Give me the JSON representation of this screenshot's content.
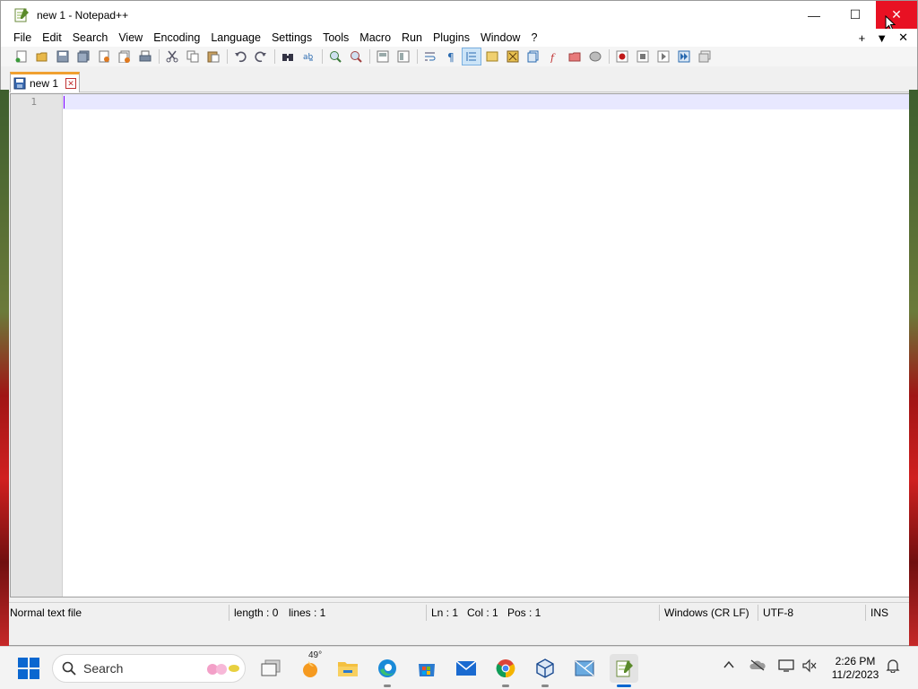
{
  "window": {
    "title": "new 1 - Notepad++",
    "controls": {
      "minimize": "—",
      "maximize": "☐",
      "close": "✕"
    }
  },
  "menu": {
    "items": [
      "File",
      "Edit",
      "Search",
      "View",
      "Encoding",
      "Language",
      "Settings",
      "Tools",
      "Macro",
      "Run",
      "Plugins",
      "Window",
      "?"
    ],
    "right_controls": [
      "+",
      "▼",
      "✕"
    ]
  },
  "toolbar": {
    "icons": [
      "new-file-icon",
      "open-file-icon",
      "save-icon",
      "save-all-icon",
      "close-icon",
      "close-all-icon",
      "print-icon",
      "cut-icon",
      "copy-icon",
      "paste-icon",
      "undo-icon",
      "redo-icon",
      "find-icon",
      "replace-icon",
      "zoom-in-icon",
      "zoom-out-icon",
      "sync-vertical-icon",
      "sync-horizontal-icon",
      "word-wrap-icon",
      "show-all-chars-icon",
      "indent-guide-icon",
      "user-language-icon",
      "doc-map-icon",
      "doc-list-icon",
      "function-list-icon",
      "folder-workspace-icon",
      "monitoring-icon",
      "record-macro-icon",
      "stop-record-icon",
      "playback-macro-icon",
      "run-macro-multiple-icon",
      "save-macro-icon"
    ]
  },
  "tab": {
    "label": "new 1",
    "close_glyph": "✕"
  },
  "editor": {
    "line_numbers": [
      "1"
    ]
  },
  "status": {
    "file_type": "Normal text file",
    "length": "length : 0",
    "lines": "lines : 1",
    "ln": "Ln : 1",
    "col": "Col : 1",
    "pos": "Pos : 1",
    "eol": "Windows (CR LF)",
    "encoding": "UTF-8",
    "mode": "INS"
  },
  "taskbar": {
    "search_label": "Search",
    "weather_temp": "49°",
    "clock_time": "2:26 PM",
    "clock_date": "11/2/2023",
    "apps": [
      "task-view-icon",
      "weather-icon",
      "file-explorer-icon",
      "edge-icon",
      "store-icon",
      "mail-icon",
      "chrome-icon",
      "virtualbox-icon",
      "sandbox-icon",
      "notepadpp-icon"
    ],
    "tray": [
      "chevron-up-icon",
      "onedrive-icon",
      "display-icon",
      "volume-muted-icon",
      "notification-icon"
    ]
  },
  "colors": {
    "close_red": "#e81123",
    "tab_accent": "#f0a030",
    "current_line": "#e8e8ff",
    "taskbar_accent": "#0a67d0"
  }
}
